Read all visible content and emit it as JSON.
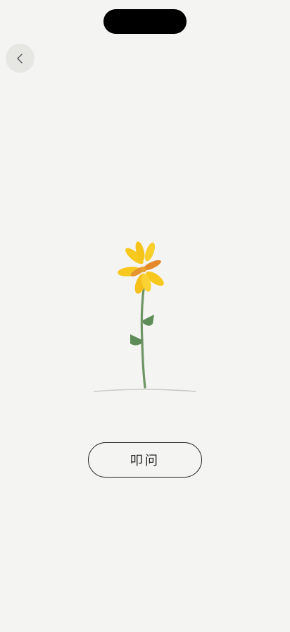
{
  "nav": {
    "back_icon": "chevron-left-icon"
  },
  "illustration": {
    "subject": "flower",
    "petal_color": "#f7c81e",
    "accent_color": "#e48a2a",
    "stem_color": "#6d9463",
    "ground_color": "#c9c9c6"
  },
  "actions": {
    "ask_label": "叩问"
  }
}
